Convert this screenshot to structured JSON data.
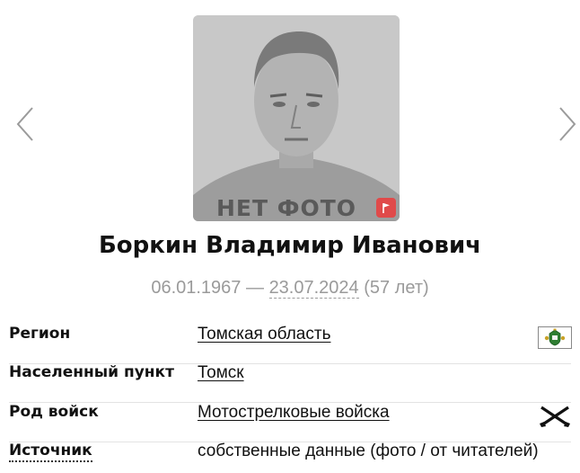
{
  "profile": {
    "photo_placeholder": "НЕТ ФОТО",
    "name": "Боркин Владимир Иванович",
    "birth_date": "06.01.1967",
    "dash": "—",
    "death_date": "23.07.2024",
    "age": "(57 лет)"
  },
  "details": [
    {
      "label": "Регион",
      "value": "Томская область",
      "icon": "region-emblem-icon"
    },
    {
      "label": "Населенный пункт",
      "value": "Томск"
    },
    {
      "label": "Род войск",
      "value": "Мотострелковые войска",
      "icon": "crossed-rifles-icon"
    },
    {
      "label": "Источник",
      "value": "собственные данные (фото / от читателей)"
    }
  ],
  "colors": {
    "flag_badge": "#e04a4a",
    "muted_text": "#9a9a9a"
  },
  "icons": {
    "prev": "chevron-left-icon",
    "next": "chevron-right-icon",
    "flag": "flag-icon"
  }
}
